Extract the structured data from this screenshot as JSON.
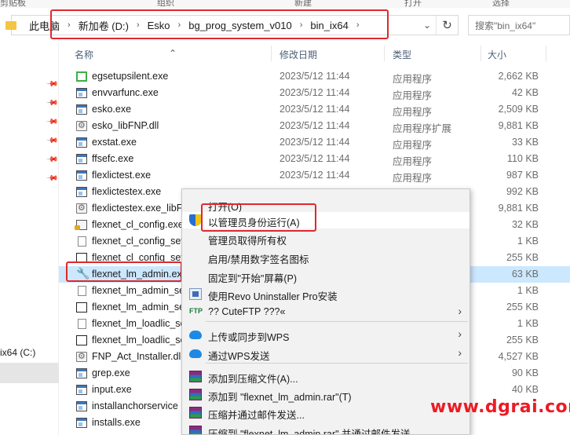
{
  "ribbon": {
    "labels": [
      "剪贴板",
      "组织",
      "新建",
      "打开",
      "选择"
    ]
  },
  "address": {
    "crumbs": [
      "此电脑",
      "新加卷 (D:)",
      "Esko",
      "bg_prog_system_v010",
      "bin_ix64"
    ],
    "separator": "›",
    "dropdown": "⌄",
    "refresh": "↻"
  },
  "search": {
    "placeholder": "搜索\"bin_ix64\""
  },
  "nav": {
    "drive_label": "ix64 (C:)"
  },
  "columns": {
    "name": "名称",
    "date": "修改日期",
    "type": "类型",
    "size": "大小"
  },
  "files": [
    {
      "name": "egsetupsilent.exe",
      "date": "2023/5/12 11:44",
      "type": "应用程序",
      "size": "2,662 KB",
      "icon": "green"
    },
    {
      "name": "envvarfunc.exe",
      "date": "2023/5/12 11:44",
      "type": "应用程序",
      "size": "42 KB",
      "icon": "exe"
    },
    {
      "name": "esko.exe",
      "date": "2023/5/12 11:44",
      "type": "应用程序",
      "size": "2,509 KB",
      "icon": "exe"
    },
    {
      "name": "esko_libFNP.dll",
      "date": "2023/5/12 11:44",
      "type": "应用程序扩展",
      "size": "9,881 KB",
      "icon": "dll"
    },
    {
      "name": "exstat.exe",
      "date": "2023/5/12 11:44",
      "type": "应用程序",
      "size": "33 KB",
      "icon": "exe"
    },
    {
      "name": "ffsefc.exe",
      "date": "2023/5/12 11:44",
      "type": "应用程序",
      "size": "110 KB",
      "icon": "exe"
    },
    {
      "name": "flexlictest.exe",
      "date": "2023/5/12 11:44",
      "type": "应用程序",
      "size": "987 KB",
      "icon": "exe"
    },
    {
      "name": "flexlictestex.exe",
      "date": "",
      "type": "",
      "size": "992 KB",
      "icon": "exe"
    },
    {
      "name": "flexlictestex.exe_libF",
      "date": "",
      "type": "",
      "size": "9,881 KB",
      "icon": "dll"
    },
    {
      "name": "flexnet_cl_config.exe",
      "date": "",
      "type": "",
      "size": "32 KB",
      "icon": "lock"
    },
    {
      "name": "flexnet_cl_config_set",
      "date": "",
      "type": "",
      "size": "1 KB",
      "icon": "page"
    },
    {
      "name": "flexnet_cl_config_set",
      "date": "",
      "type": "",
      "size": "255 KB",
      "icon": "plain"
    },
    {
      "name": "flexnet_lm_admin.exe",
      "date": "",
      "type": "",
      "size": "63 KB",
      "icon": "wrench",
      "selected": true
    },
    {
      "name": "flexnet_lm_admin_se",
      "date": "",
      "type": "",
      "size": "1 KB",
      "icon": "page"
    },
    {
      "name": "flexnet_lm_admin_se",
      "date": "",
      "type": "",
      "size": "255 KB",
      "icon": "plain"
    },
    {
      "name": "flexnet_lm_loadlic_se",
      "date": "",
      "type": "",
      "size": "1 KB",
      "icon": "page"
    },
    {
      "name": "flexnet_lm_loadlic_se",
      "date": "",
      "type": "",
      "size": "255 KB",
      "icon": "plain"
    },
    {
      "name": "FNP_Act_Installer.dll",
      "date": "",
      "type": "",
      "size": "4,527 KB",
      "icon": "dll"
    },
    {
      "name": "grep.exe",
      "date": "",
      "type": "",
      "size": "90 KB",
      "icon": "exe"
    },
    {
      "name": "input.exe",
      "date": "",
      "type": "",
      "size": "40 KB",
      "icon": "exe"
    },
    {
      "name": "installanchorservice",
      "date": "",
      "type": "",
      "size": "",
      "icon": "exe"
    },
    {
      "name": "installs.exe",
      "date": "",
      "type": "",
      "size": "",
      "icon": "exe"
    }
  ],
  "context_menu": {
    "items": [
      {
        "label": "打开(O)",
        "icon": "",
        "arrow": ""
      },
      {
        "label": "以管理员身份运行(A)",
        "icon": "shield",
        "arrow": ""
      },
      {
        "label": "管理员取得所有权",
        "icon": "",
        "arrow": ""
      },
      {
        "label": "启用/禁用数字签名图标",
        "icon": "",
        "arrow": ""
      },
      {
        "label": "固定到\"开始\"屏幕(P)",
        "icon": "",
        "arrow": ""
      },
      {
        "label": "使用Revo Uninstaller Pro安装",
        "icon": "revo",
        "arrow": ""
      },
      {
        "label": "?? CuteFTP ???«",
        "icon": "cute",
        "arrow": "›"
      },
      {
        "label": "上传或同步到WPS",
        "icon": "cloud",
        "arrow": "›"
      },
      {
        "label": "通过WPS发送",
        "icon": "wps",
        "arrow": "›"
      },
      {
        "label": "添加到压缩文件(A)...",
        "icon": "rar",
        "arrow": ""
      },
      {
        "label": "添加到 \"flexnet_lm_admin.rar\"(T)",
        "icon": "rar",
        "arrow": ""
      },
      {
        "label": "压缩并通过邮件发送...",
        "icon": "rar",
        "arrow": ""
      },
      {
        "label": "压缩到 \"flexnet_lm_admin.rar\" 并通过邮件发送",
        "icon": "rar",
        "arrow": ""
      }
    ],
    "cute_icon_text": "FTP"
  },
  "watermark": "www.dgrai.com",
  "colors": {
    "highlight": "#e0282e",
    "selection": "#cce8ff",
    "watermark": "#ec1b24"
  }
}
